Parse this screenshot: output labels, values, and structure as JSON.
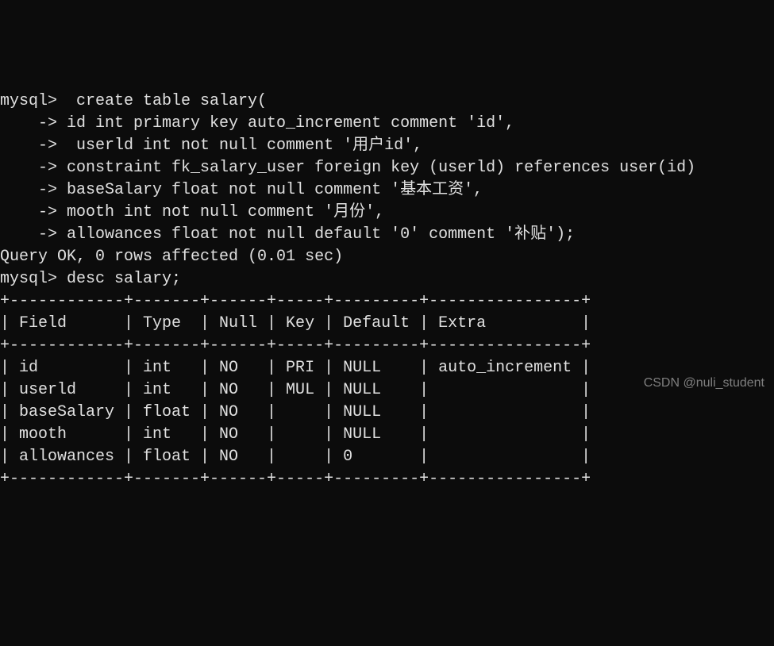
{
  "lines": {
    "l01": "mysql>  create table salary(",
    "l02": "    -> id int primary key auto_increment comment 'id',",
    "l03": "    ->  userld int not null comment '用户id',",
    "l04": "    -> constraint fk_salary_user foreign key (userld) references user(id)",
    "l05": "    -> baseSalary float not null comment '基本工资',",
    "l06": "    -> mooth int not null comment '月份',",
    "l07": "    -> allowances float not null default '0' comment '补贴');",
    "l08": "Query OK, 0 rows affected (0.01 sec)",
    "l09": "",
    "l10": "mysql> desc salary;",
    "l11": "+------------+-------+------+-----+---------+----------------+",
    "l12": "| Field      | Type  | Null | Key | Default | Extra          |",
    "l13": "+------------+-------+------+-----+---------+----------------+",
    "l14": "| id         | int   | NO   | PRI | NULL    | auto_increment |",
    "l15": "| userld     | int   | NO   | MUL | NULL    |                |",
    "l16": "| baseSalary | float | NO   |     | NULL    |                |",
    "l17": "| mooth      | int   | NO   |     | NULL    |                |",
    "l18": "| allowances | float | NO   |     | 0       |                |",
    "l19": "+------------+-------+------+-----+---------+----------------+"
  },
  "watermark": "CSDN @nuli_student",
  "chart_data": {
    "type": "table",
    "title": "desc salary",
    "columns": [
      "Field",
      "Type",
      "Null",
      "Key",
      "Default",
      "Extra"
    ],
    "rows": [
      [
        "id",
        "int",
        "NO",
        "PRI",
        "NULL",
        "auto_increment"
      ],
      [
        "userld",
        "int",
        "NO",
        "MUL",
        "NULL",
        ""
      ],
      [
        "baseSalary",
        "float",
        "NO",
        "",
        "NULL",
        ""
      ],
      [
        "mooth",
        "int",
        "NO",
        "",
        "NULL",
        ""
      ],
      [
        "allowances",
        "float",
        "NO",
        "",
        "0",
        ""
      ]
    ]
  }
}
